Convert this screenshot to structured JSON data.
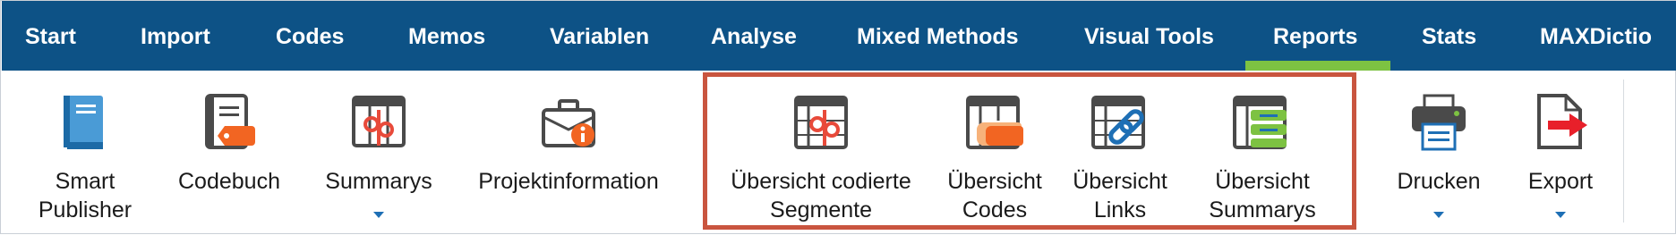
{
  "menu": {
    "tabs": [
      {
        "label": "Start"
      },
      {
        "label": "Import"
      },
      {
        "label": "Codes"
      },
      {
        "label": "Memos"
      },
      {
        "label": "Variablen"
      },
      {
        "label": "Analyse"
      },
      {
        "label": "Mixed Methods"
      },
      {
        "label": "Visual Tools"
      },
      {
        "label": "Reports",
        "active": true
      },
      {
        "label": "Stats"
      },
      {
        "label": "MAXDictio"
      }
    ],
    "active_underline_color": "#7dc242",
    "bar_color": "#0d5286"
  },
  "ribbon": {
    "items": [
      {
        "line1": "Smart",
        "line2": "Publisher",
        "icon": "book-icon"
      },
      {
        "line1": "Codebuch",
        "line2": "",
        "icon": "codebook-icon"
      },
      {
        "line1": "Summarys",
        "line2": "",
        "icon": "summarys-icon",
        "dropdown": true
      },
      {
        "line1": "Projektinformation",
        "line2": "",
        "icon": "briefcase-info-icon"
      },
      {
        "line1": "Übersicht codierte",
        "line2": "Segmente",
        "icon": "coded-segments-table-icon"
      },
      {
        "line1": "Übersicht",
        "line2": "Codes",
        "icon": "codes-table-icon"
      },
      {
        "line1": "Übersicht",
        "line2": "Links",
        "icon": "links-table-icon"
      },
      {
        "line1": "Übersicht",
        "line2": "Summarys",
        "icon": "summarys-table-icon"
      },
      {
        "line1": "Drucken",
        "line2": "",
        "icon": "printer-icon",
        "dropdown": true
      },
      {
        "line1": "Export",
        "line2": "",
        "icon": "export-icon",
        "dropdown": true
      }
    ],
    "highlight_color": "#c9553f"
  }
}
